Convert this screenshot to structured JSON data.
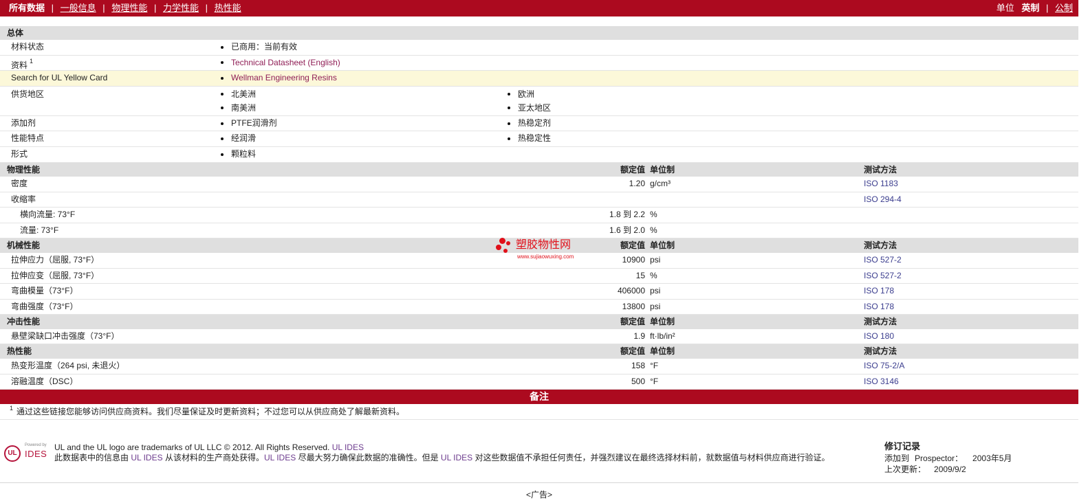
{
  "colors": {
    "brand_red": "#ac0a1f",
    "section_grey": "#dfdfdf",
    "highlight_yellow": "#fcf8d9",
    "link": "#8f1d55",
    "test_method": "#3b3d8e",
    "ides_link": "#6d3c8e"
  },
  "nav": {
    "all_data": "所有数据",
    "separator": "|",
    "links": [
      "一般信息",
      "物理性能",
      "力学性能",
      "热性能"
    ],
    "units_label": "单位",
    "unit_imperial": "英制",
    "unit_metric": "公制"
  },
  "general": {
    "title": "总体",
    "rows": [
      {
        "label": "材料状态",
        "col1": [
          "已商用：当前有效"
        ]
      },
      {
        "label": "资料",
        "sup": "1",
        "col1": [
          "Technical Datasheet (English)"
        ]
      },
      {
        "label": "Search for UL Yellow Card",
        "col1": [
          "Wellman Engineering Resins"
        ]
      },
      {
        "label": "供货地区",
        "col1": [
          "北美洲",
          "南美洲"
        ],
        "col2": [
          "欧洲",
          "亚太地区"
        ]
      },
      {
        "label": "添加剂",
        "col1": [
          "PTFE润滑剂"
        ],
        "col2": [
          "热稳定剂"
        ]
      },
      {
        "label": "性能特点",
        "col1": [
          "经润滑"
        ],
        "col2": [
          "热稳定性"
        ]
      },
      {
        "label": "形式",
        "col1": [
          "颗粒料"
        ]
      }
    ]
  },
  "sections": [
    {
      "title": "物理性能",
      "col_value": "额定值",
      "col_unit": "单位制",
      "col_method": "测试方法",
      "rows": [
        {
          "label": "密度",
          "value": "1.20",
          "unit": "g/cm³",
          "method": "ISO 1183"
        },
        {
          "label": "收缩率",
          "method": "ISO 294-4"
        },
        {
          "label": "横向流量: 73°F",
          "value": "1.8 到 2.2",
          "unit": "%"
        },
        {
          "label": "流量: 73°F",
          "value": "1.6 到 2.0",
          "unit": "%"
        }
      ]
    },
    {
      "title": "机械性能",
      "col_value": "额定值",
      "col_unit": "单位制",
      "col_method": "测试方法",
      "rows": [
        {
          "label": "拉伸应力（屈服, 73°F）",
          "value": "10900",
          "unit": "psi",
          "method": "ISO 527-2"
        },
        {
          "label": "拉伸应变（屈服, 73°F）",
          "value": "15",
          "unit": "%",
          "method": "ISO 527-2"
        },
        {
          "label": "弯曲模量（73°F）",
          "value": "406000",
          "unit": "psi",
          "method": "ISO 178"
        },
        {
          "label": "弯曲强度（73°F）",
          "value": "13800",
          "unit": "psi",
          "method": "ISO 178"
        }
      ]
    },
    {
      "title": "冲击性能",
      "col_value": "额定值",
      "col_unit": "单位制",
      "col_method": "测试方法",
      "rows": [
        {
          "label": "悬壁梁缺口冲击强度（73°F）",
          "value": "1.9",
          "unit": "ft·lb/in²",
          "method": "ISO 180"
        }
      ]
    },
    {
      "title": "热性能",
      "col_value": "额定值",
      "col_unit": "单位制",
      "col_method": "测试方法",
      "rows": [
        {
          "label": "热变形温度（264 psi, 未退火）",
          "value": "158",
          "unit": "°F",
          "method": "ISO 75-2/A"
        },
        {
          "label": "溶融温度（DSC）",
          "value": "500",
          "unit": "°F",
          "method": "ISO 3146"
        }
      ]
    }
  ],
  "notes": {
    "title": "备注",
    "mark": "1",
    "text": "通过这些链接您能够访问供应商资料。我们尽量保证及时更新资料；不过您可以从供应商处了解最新资料。"
  },
  "footer": {
    "logo": {
      "mark": "UL",
      "powered_by": "Powered by",
      "brand": "IDES"
    },
    "trademark": "UL and the UL logo are trademarks of UL LLC © 2012. All Rights Reserved.",
    "trademark_link": "UL IDES",
    "disclaimer": [
      "此数据表中的信息由",
      "UL IDES",
      "从该材料的生产商处获得。",
      "UL IDES",
      "尽最大努力确保此数据的准确性。但是",
      "UL IDES",
      "对这些数据值不承担任何责任，并强烈建议在最终选择材料前，就数据值与材料供应商进行验证。"
    ],
    "revision": {
      "title": "修订记录",
      "added_label": "添加到",
      "added_source": "Prospector：",
      "added_date": "2003年5月",
      "updated_label": "上次更新：",
      "updated_date": "2009/9/2"
    }
  },
  "ad_label": "<广告>",
  "watermark": {
    "name": "塑胶物性网",
    "url": "www.sujiaowuxing.com"
  }
}
